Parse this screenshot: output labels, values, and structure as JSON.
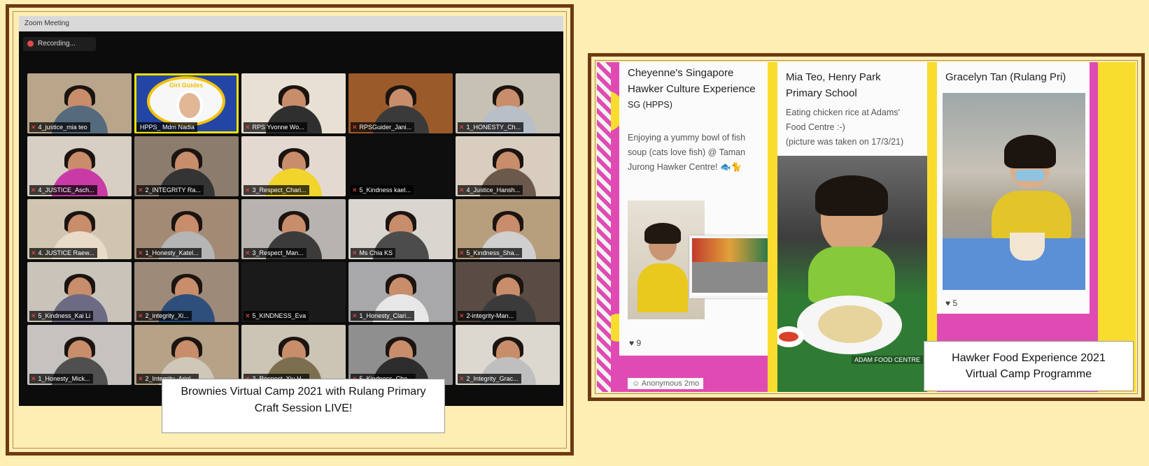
{
  "zoom": {
    "window_title": "Zoom Meeting",
    "recording_label": "Recording...",
    "participants": [
      "4_justice_mia teo",
      "HPPS_ Mdm Nadia",
      "RPS Yvonne Wo...",
      "RPSGuider_Jani...",
      "1_HONESTY_Ch...",
      "4_JUSTICE_Asch...",
      "2_INTEGRITY Ra...",
      "3_Respect_Chari...",
      "5_Kindness kael...",
      "4_Justice_Hansh...",
      "4. JUSTICE Raew...",
      "1_Honesty_Katel...",
      "3_Respect_Man...",
      "Ms Chia KS",
      "5_Kindness_Sha...",
      "5_Kindness_Kai Li",
      "2_integrity_Xi...",
      "5_KINDNESS_Eva",
      "1_Honesty_Clari...",
      "2-integrity-Man...",
      "1_Honesty_Mick...",
      "2_Integrity_Ariel...",
      "3_Respect_Xiu H...",
      "5_Kindness_Che...",
      "2_Integrity_Grac..."
    ],
    "logo_text": "Girl Guides"
  },
  "caption_left": {
    "line1": "Brownies Virtual Camp 2021 with Rulang Primary",
    "line2": "Craft Session LIVE!"
  },
  "padlet": {
    "cards": [
      {
        "title_line1": "Cheyenne's Singapore",
        "title_line2": "Hawker Culture Experience",
        "title_line3": "SG (HPPS)",
        "body_line1": "Enjoying a yummy bowl of fish",
        "body_line2": "soup (cats love fish) @ Taman",
        "body_line3": "Jurong Hawker Centre! 🐟🐈",
        "likes": "9"
      },
      {
        "title_line1": "Mia Teo, Henry Park",
        "title_line2": "Primary School",
        "body_line1": "Eating chicken rice at Adams'",
        "body_line2": "Food Centre :-)",
        "body_line3": "(picture was taken on 17/3/21)",
        "sign_text": "ADAM FOOD CENTRE"
      },
      {
        "title_line1": "Gracelyn Tan (Rulang Pri)",
        "likes": "5"
      }
    ],
    "anonymous_label": "Anonymous",
    "anonymous_time": "2mo"
  },
  "caption_right": {
    "line1": "Hawker Food Experience 2021",
    "line2": "Virtual Camp Programme"
  },
  "colors": {
    "frame": "#6e3a12",
    "background": "#fdeeb4",
    "padlet_pink": "#e04bb3",
    "padlet_yellow": "#f8dd2e",
    "active_speaker": "#f0e100"
  }
}
